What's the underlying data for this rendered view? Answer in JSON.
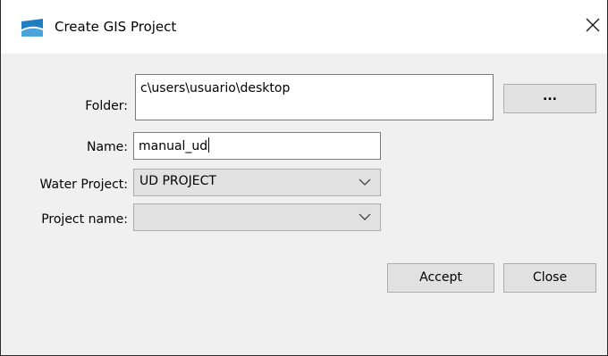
{
  "window": {
    "title": "Create GIS Project",
    "icon": "app-logo-icon",
    "close_icon": "close-icon",
    "accent": "#1f7dc1"
  },
  "form": {
    "folder": {
      "label": "Folder:",
      "value": "c\\users\\usuario\\desktop"
    },
    "name": {
      "label": "Name:",
      "value": "manual_ud"
    },
    "water_project": {
      "label": "Water Project:",
      "selected": "UD PROJECT"
    },
    "project_name": {
      "label": "Project name:",
      "selected": ""
    }
  },
  "buttons": {
    "browse": "...",
    "accept": "Accept",
    "close": "Close"
  }
}
